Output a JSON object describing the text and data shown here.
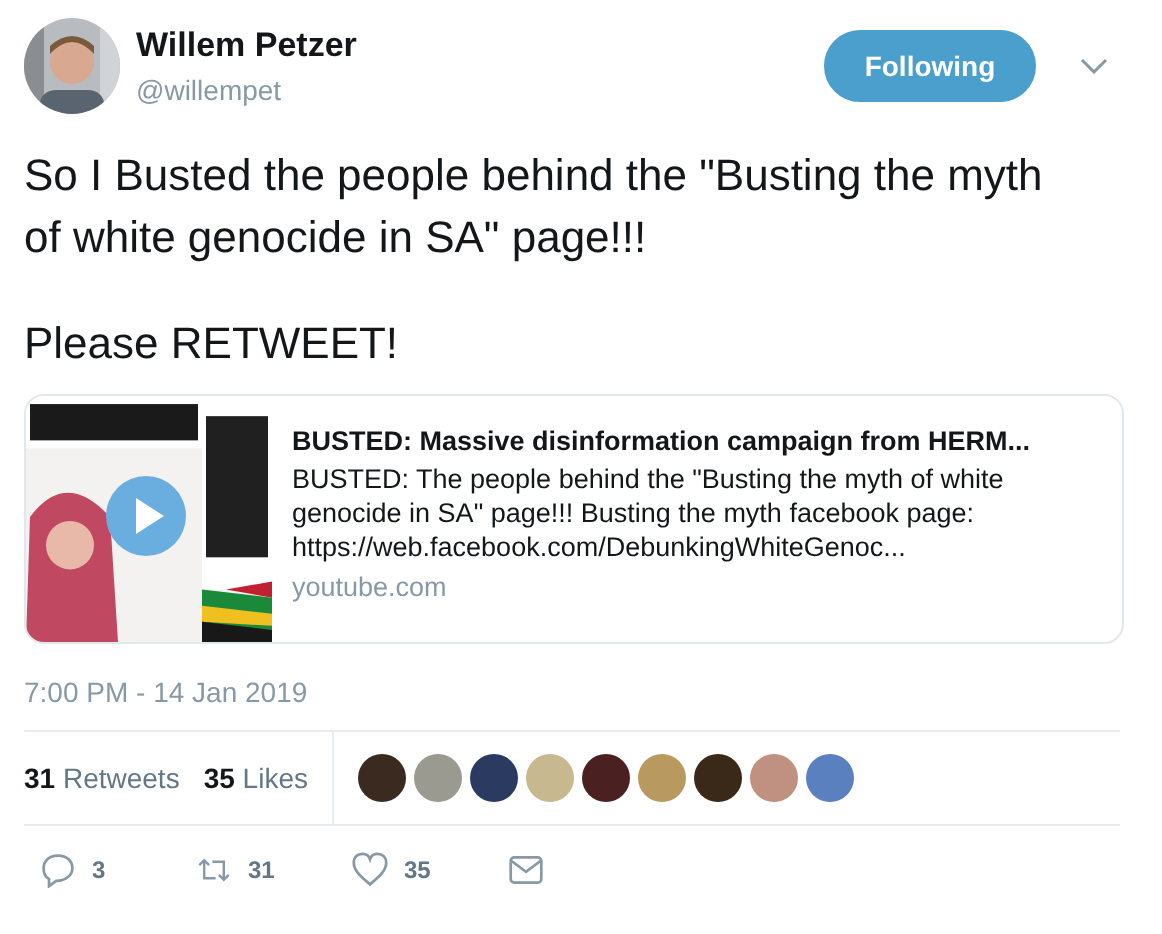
{
  "author": {
    "name": "Willem Petzer",
    "handle": "@willempet"
  },
  "follow_button": {
    "label": "Following",
    "selected": true
  },
  "tweet_text": [
    "So I Busted the people behind the \"Busting the myth of white genocide in SA\" page!!!",
    "Please RETWEET!"
  ],
  "link_card": {
    "title": "BUSTED: Massive disinformation campaign from HERM...",
    "description": "BUSTED: The people behind the \"Busting the myth of white genocide in SA\" page!!! Busting the myth facebook page: https://web.facebook.com/DebunkingWhiteGenoc...",
    "domain": "youtube.com"
  },
  "timestamp": "7:00 PM - 14 Jan 2019",
  "stats": [
    {
      "count": "31",
      "label": "Retweets"
    },
    {
      "count": "35",
      "label": "Likes"
    }
  ],
  "liker_avatars": [
    {
      "color": "#3a2a20"
    },
    {
      "color": "#9a9a90"
    },
    {
      "color": "#2a3a60"
    },
    {
      "color": "#c8b890"
    },
    {
      "color": "#4a2020"
    },
    {
      "color": "#b89a60"
    },
    {
      "color": "#3a2818"
    },
    {
      "color": "#c09080"
    },
    {
      "color": "#5a80c0"
    }
  ],
  "actions": [
    {
      "kind": "reply",
      "count": "3"
    },
    {
      "kind": "retweet",
      "count": "31"
    },
    {
      "kind": "like",
      "count": "35"
    },
    {
      "kind": "message"
    }
  ]
}
